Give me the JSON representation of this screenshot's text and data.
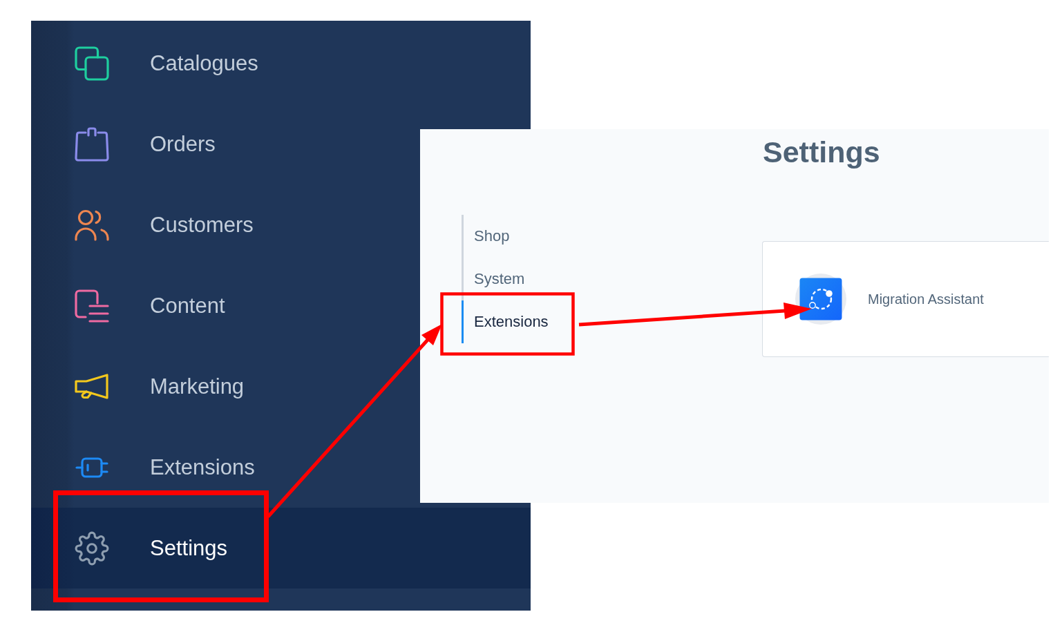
{
  "sidebar": {
    "items": [
      {
        "label": "Catalogues",
        "color": "#1ecf9f",
        "selected": false
      },
      {
        "label": "Orders",
        "color": "#8a8bea",
        "selected": false
      },
      {
        "label": "Customers",
        "color": "#ee8650",
        "selected": false
      },
      {
        "label": "Content",
        "color": "#ef6aa1",
        "selected": false
      },
      {
        "label": "Marketing",
        "color": "#f3c81d",
        "selected": false
      },
      {
        "label": "Extensions",
        "color": "#1d8af5",
        "selected": false
      },
      {
        "label": "Settings",
        "color": "#8e9eb0",
        "selected": true
      }
    ]
  },
  "settings": {
    "title": "Settings",
    "menu": [
      {
        "label": "Shop",
        "selected": false
      },
      {
        "label": "System",
        "selected": false
      },
      {
        "label": "Extensions",
        "selected": true
      }
    ],
    "extensions": [
      {
        "name": "Migration Assistant"
      }
    ]
  }
}
